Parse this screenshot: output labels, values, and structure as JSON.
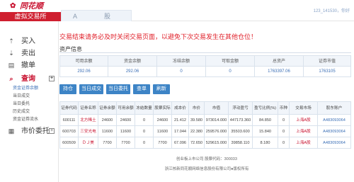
{
  "header": {
    "logo_text": "同花顺",
    "sim_tab": "虚拟交易所",
    "market_tab_a": "A",
    "market_tab_b": "股",
    "user": "123_141530，你好"
  },
  "sidebar": {
    "items": [
      {
        "label": "买入",
        "icon": "buy-icon",
        "glyph": "⇡"
      },
      {
        "label": "卖出",
        "icon": "sell-icon",
        "glyph": "⇣"
      },
      {
        "label": "撤单",
        "icon": "cancel-order-icon",
        "glyph": "▤"
      },
      {
        "label": "查询",
        "icon": "search-icon",
        "glyph": "⌕"
      },
      {
        "label": "市价委托",
        "icon": "market-order-icon",
        "glyph": "▦"
      }
    ],
    "sub_items": [
      "资金证券余额",
      "当日成交",
      "当日委托",
      "历史成交",
      "资金证券流水"
    ],
    "toggle_plus": "+"
  },
  "main": {
    "warning": "交易结束请务必及时关闭交易页面，以避免下次交易发生在其他仓位！",
    "asset_title": "资产信息",
    "asset_headers": [
      "可用余额",
      "资金余额",
      "冻结余额",
      "可取金额",
      "总资产",
      "证券市值"
    ],
    "asset_values": [
      "292.06",
      "292.06",
      "0",
      "0",
      "1763397.06",
      "1763105"
    ],
    "buttons": [
      "持仓",
      "当日成交",
      "当日委托",
      "查单",
      "刷新"
    ],
    "holding_headers": [
      "证券代码",
      "证券名称",
      "证券余额",
      "可用余额",
      "冻结数量",
      "股票实际",
      "成本价",
      "市价",
      "市值",
      "浮动盈亏",
      "盈亏比例(%)",
      "币种",
      "交易市场",
      "股东账户"
    ],
    "holdings": [
      [
        "600111",
        "北方稀土",
        "24600",
        "24600",
        "0",
        "24600",
        "21.412",
        "39.580",
        "973014.000",
        "447173.360",
        "84.850",
        "0",
        "上海A股",
        "A483093064"
      ],
      [
        "600703",
        "三安光电",
        "11600",
        "11600",
        "0",
        "11600",
        "17.044",
        "22.380",
        "259576.000",
        "35503.600",
        "15.840",
        "0",
        "上海A股",
        "A483093064"
      ],
      [
        "600509",
        "ＤＪ美",
        "7700",
        "7700",
        "0",
        "7700",
        "67.096",
        "72.650",
        "529615.000",
        "39858.110",
        "8.180",
        "0",
        "上海A股",
        "A483093064"
      ]
    ],
    "footer_line1": "创业板上市公司  股票代码：300033",
    "footer_line2": "浙江核新同花顺网络信息股份有限公司●版权所有"
  }
}
